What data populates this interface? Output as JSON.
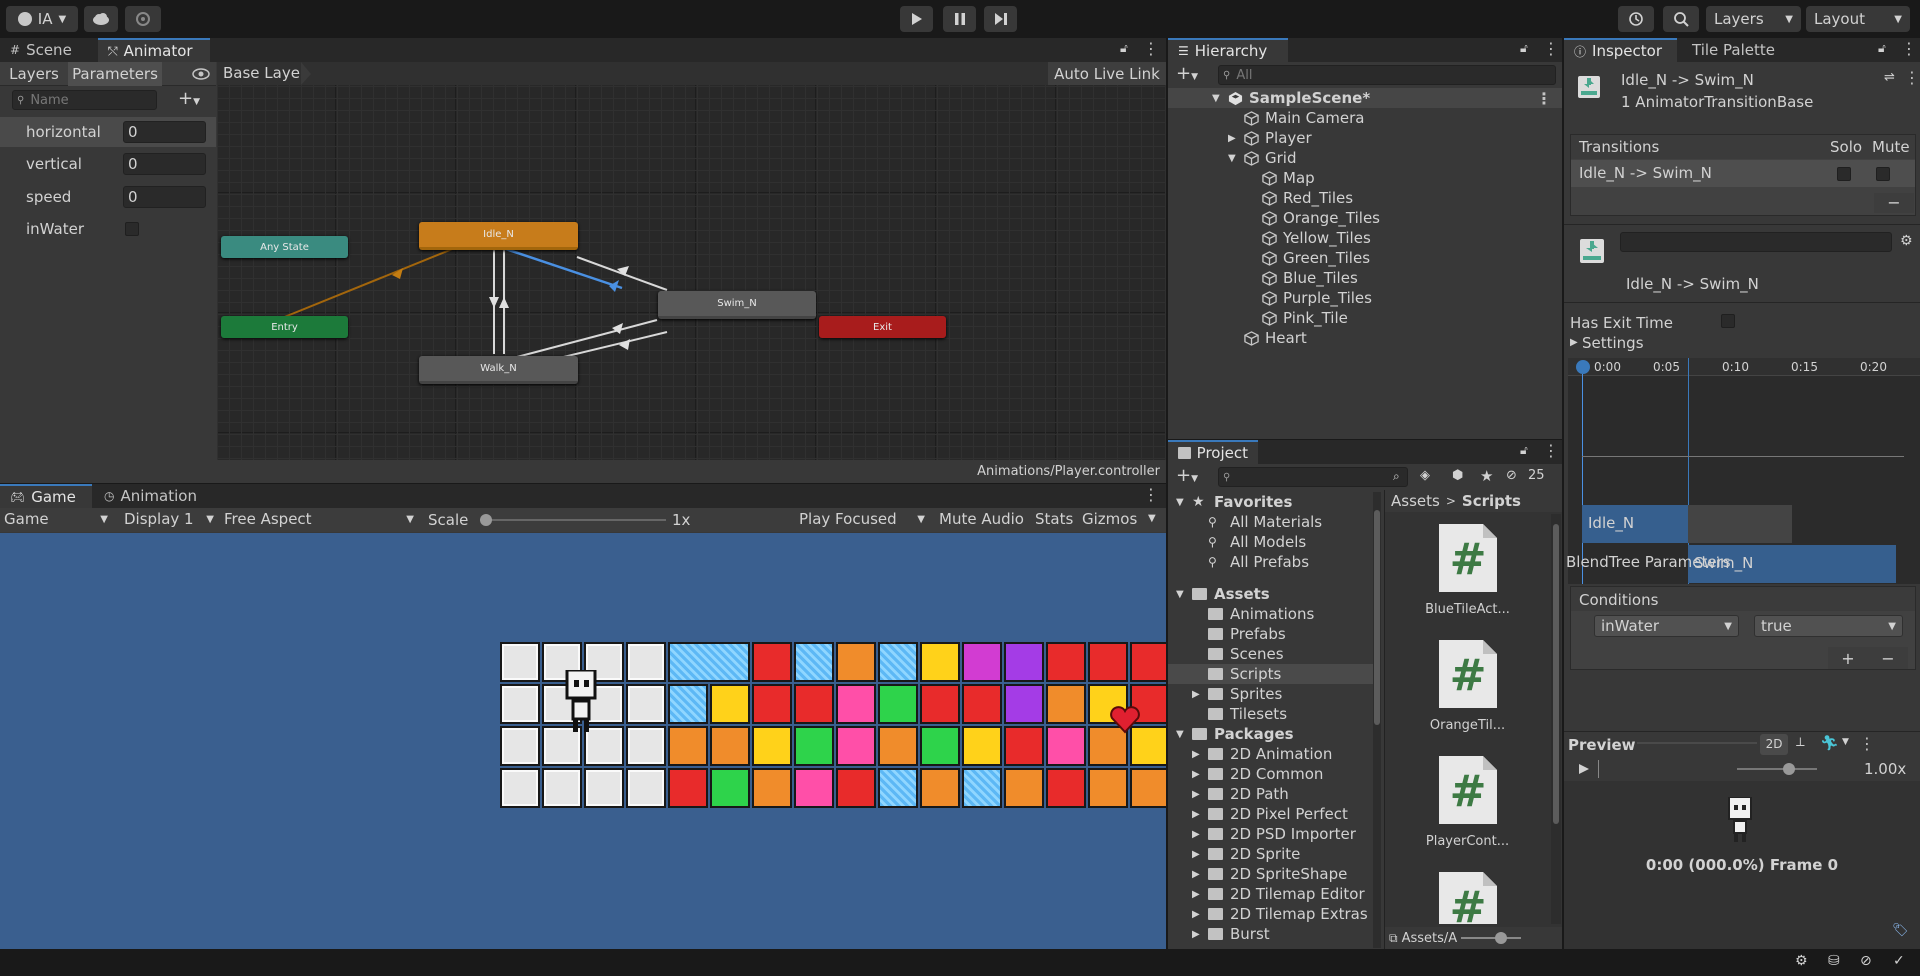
{
  "toolbar": {
    "account": "IA",
    "layers": "Layers",
    "layout": "Layout"
  },
  "scene_tabs": {
    "scene": "Scene",
    "animator": "Animator"
  },
  "animator": {
    "layers_tab": "Layers",
    "parameters_tab": "Parameters",
    "base_layer": "Base Layer",
    "auto_live_link": "Auto Live Link",
    "search_placeholder": "Name",
    "params": [
      {
        "name": "horizontal",
        "value": "0"
      },
      {
        "name": "vertical",
        "value": "0"
      },
      {
        "name": "speed",
        "value": "0"
      },
      {
        "name": "inWater",
        "value": ""
      }
    ],
    "nodes": {
      "any_state": "Any State",
      "entry": "Entry",
      "idle": "Idle_N",
      "swim": "Swim_N",
      "walk": "Walk_N",
      "exit": "Exit"
    },
    "path": "Animations/Player.controller"
  },
  "colors": {
    "orange_node": "#c77c1b",
    "entry": "#1c7a3a",
    "any_state": "#3a8b80",
    "exit": "#a81c1c",
    "game_bg": "#3a5f8f",
    "accent": "#3a79bb"
  },
  "hierarchy": {
    "title": "Hierarchy",
    "search_placeholder": "All",
    "scene": "SampleScene*",
    "items": [
      {
        "label": "Main Camera",
        "level": 1
      },
      {
        "label": "Player",
        "level": 1,
        "arrow": "▶"
      },
      {
        "label": "Grid",
        "level": 1,
        "arrow": "▼"
      },
      {
        "label": "Map",
        "level": 2
      },
      {
        "label": "Red_Tiles",
        "level": 2
      },
      {
        "label": "Orange_Tiles",
        "level": 2
      },
      {
        "label": "Yellow_Tiles",
        "level": 2
      },
      {
        "label": "Green_Tiles",
        "level": 2
      },
      {
        "label": "Blue_Tiles",
        "level": 2
      },
      {
        "label": "Purple_Tiles",
        "level": 2
      },
      {
        "label": "Pink_Tile",
        "level": 2
      },
      {
        "label": "Heart",
        "level": 1
      }
    ]
  },
  "inspector": {
    "tab": "Inspector",
    "tile_palette": "Tile Palette",
    "title": "Idle_N -> Swim_N",
    "subtitle": "1 AnimatorTransitionBase",
    "transitions_label": "Transitions",
    "solo": "Solo",
    "mute": "Mute",
    "transition_item": "Idle_N -> Swim_N",
    "transition_name": "Idle_N -> Swim_N",
    "has_exit_time": "Has Exit Time",
    "settings": "Settings",
    "timeline_ticks": [
      "0:00",
      "0:05",
      "0:10",
      "0:15",
      "0:20"
    ],
    "clip_a": "Idle_N",
    "clip_b": "Swim_N",
    "blend_tree": "BlendTree Parameters",
    "conditions": "Conditions",
    "cond_param": "inWater",
    "cond_value": "true",
    "preview": "Preview",
    "preview_2d": "2D",
    "preview_speed": "1.00x",
    "preview_time": "0:00 (000.0%) Frame 0"
  },
  "game": {
    "game_tab": "Game",
    "animation_tab": "Animation",
    "mode": "Game",
    "display": "Display 1",
    "aspect": "Free Aspect",
    "scale_label": "Scale",
    "scale_value": "1x",
    "play_focused": "Play Focused",
    "mute_audio": "Mute Audio",
    "stats": "Stats",
    "gizmos": "Gizmos"
  },
  "project": {
    "title": "Project",
    "hidden_count": "25",
    "favorites": "Favorites",
    "fav_items": [
      "All Materials",
      "All Models",
      "All Prefabs"
    ],
    "assets": "Assets",
    "asset_folders": [
      {
        "label": "Animations",
        "arrow": ""
      },
      {
        "label": "Prefabs",
        "arrow": ""
      },
      {
        "label": "Scenes",
        "arrow": ""
      },
      {
        "label": "Scripts",
        "arrow": ""
      },
      {
        "label": "Sprites",
        "arrow": "▶"
      },
      {
        "label": "Tilesets",
        "arrow": ""
      }
    ],
    "packages": "Packages",
    "packages_list": [
      "2D Animation",
      "2D Common",
      "2D Path",
      "2D Pixel Perfect",
      "2D PSD Importer",
      "2D Sprite",
      "2D SpriteShape",
      "2D Tilemap Editor",
      "2D Tilemap Extras",
      "Burst"
    ],
    "breadcrumb_assets": "Assets",
    "breadcrumb_scripts": "Scripts",
    "files": [
      "BlueTileAct...",
      "OrangeTil...",
      "PlayerCont...",
      ""
    ],
    "footer_path": "Assets/A"
  }
}
